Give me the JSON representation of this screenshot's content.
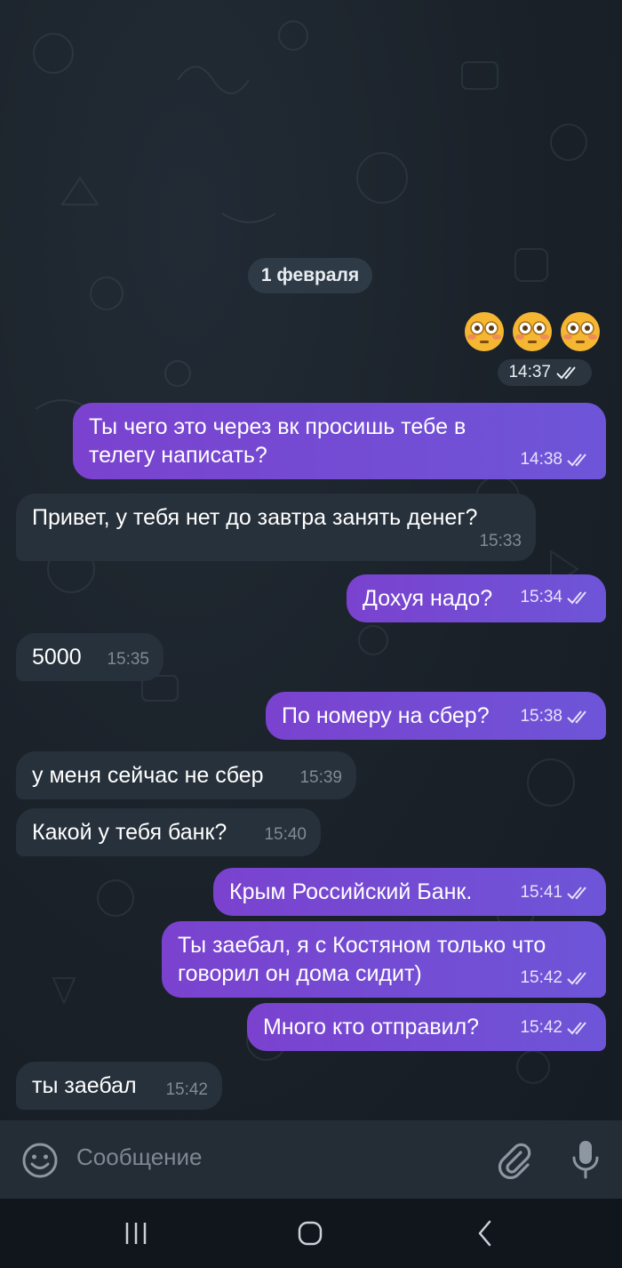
{
  "date_separator": "1 февраля",
  "emoji_message": {
    "emojis": [
      "flushed-face-emoji",
      "flushed-face-emoji",
      "flushed-face-emoji"
    ],
    "time": "14:37"
  },
  "messages": [
    {
      "dir": "out",
      "text": "Ты чего это через вк просишь тебе в телегу написать?",
      "time": "14:38"
    },
    {
      "dir": "in",
      "text": "Привет, у тебя нет до завтра занять денег?",
      "time": "15:33"
    },
    {
      "dir": "out",
      "text": "Дохуя надо?",
      "time": "15:34"
    },
    {
      "dir": "in",
      "text": "5000",
      "time": "15:35"
    },
    {
      "dir": "out",
      "text": "По номеру на сбер?",
      "time": "15:38"
    },
    {
      "dir": "in",
      "text": "у меня сейчас не сбер",
      "time": "15:39"
    },
    {
      "dir": "in",
      "text": "Какой у тебя банк?",
      "time": "15:40"
    },
    {
      "dir": "out",
      "text": "Крым Российский Банк.",
      "time": "15:41"
    },
    {
      "dir": "out",
      "text": "Ты заебал, я с Костяном только что говорил он дома сидит)",
      "time": "15:42"
    },
    {
      "dir": "out",
      "text": "Много кто отправил?",
      "time": "15:42"
    },
    {
      "dir": "in",
      "text": "ты заебал",
      "time": "15:42"
    }
  ],
  "composer": {
    "placeholder": "Сообщение"
  },
  "icons": {
    "emoji_button": "smiley-icon",
    "attach_button": "paperclip-icon",
    "mic_button": "microphone-icon",
    "nav": [
      "recent-apps-icon",
      "home-icon",
      "back-icon"
    ]
  },
  "colors": {
    "background": "#1a2129",
    "outgoing_bubble": "#7a42cf",
    "incoming_bubble": "#27313b",
    "date_pill": "#2e3a45"
  }
}
